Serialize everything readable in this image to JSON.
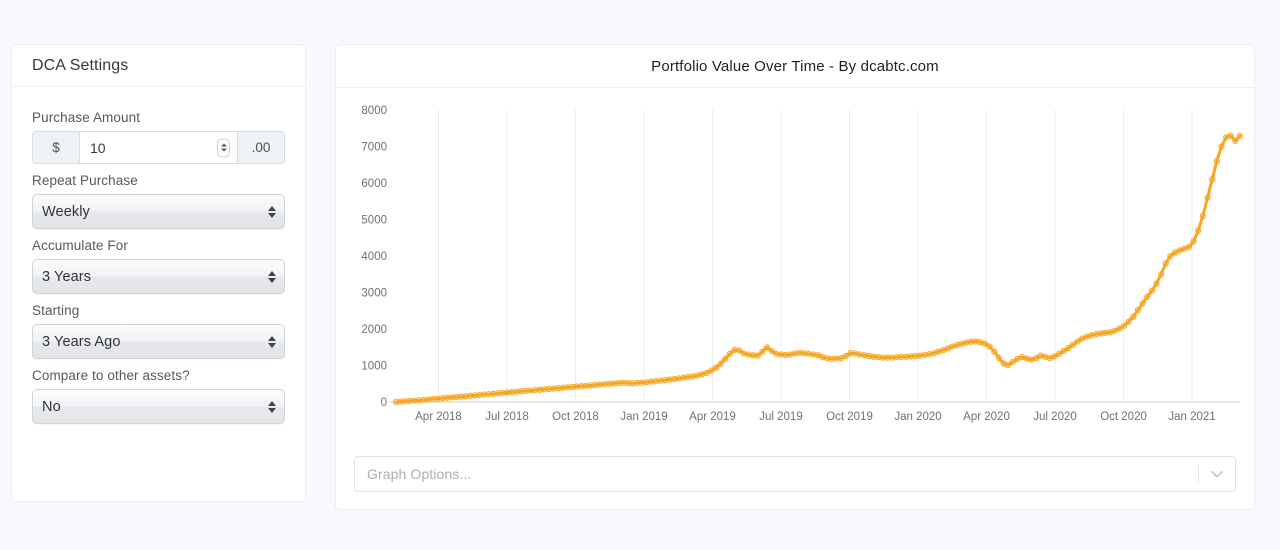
{
  "sidebar": {
    "title": "DCA Settings",
    "fields": {
      "purchase_amount": {
        "label": "Purchase Amount",
        "currency_symbol": "$",
        "value": "10",
        "cents_suffix": ".00"
      },
      "repeat_purchase": {
        "label": "Repeat Purchase",
        "value": "Weekly"
      },
      "accumulate_for": {
        "label": "Accumulate For",
        "value": "3 Years"
      },
      "starting": {
        "label": "Starting",
        "value": "3 Years Ago"
      },
      "compare": {
        "label": "Compare to other assets?",
        "value": "No"
      }
    }
  },
  "chart_panel": {
    "title": "Portfolio Value Over Time - By dcabtc.com",
    "graph_options_placeholder": "Graph Options...",
    "dropdown_icon": "chevron-down-icon"
  },
  "colors": {
    "series": "#f5a623",
    "page_background": "#f7f9fc",
    "card_border": "#e9edf2",
    "gridline": "#ececf0",
    "axis_text": "#6d7175"
  },
  "chart_data": {
    "type": "line",
    "title": "Portfolio Value Over Time - By dcabtc.com",
    "xlabel": "",
    "ylabel": "",
    "ylim": [
      0,
      8000
    ],
    "yticks": [
      0,
      1000,
      2000,
      3000,
      4000,
      5000,
      6000,
      7000,
      8000
    ],
    "xticks": [
      "Apr 2018",
      "Jul 2018",
      "Oct 2018",
      "Jan 2019",
      "Apr 2019",
      "Jul 2019",
      "Oct 2019",
      "Jan 2020",
      "Apr 2020",
      "Jul 2020",
      "Oct 2020",
      "Jan 2021"
    ],
    "grid": "vertical-only",
    "legend": "none",
    "markers": "open-circle",
    "series": [
      {
        "name": "Portfolio Value",
        "color": "#f5a623",
        "x_start": "Jan 2018",
        "x_end": "Jan 2021",
        "values": [
          0,
          10,
          20,
          30,
          42,
          52,
          60,
          72,
          84,
          92,
          104,
          115,
          126,
          136,
          148,
          158,
          170,
          182,
          192,
          204,
          214,
          226,
          238,
          248,
          260,
          272,
          282,
          294,
          304,
          316,
          326,
          336,
          348,
          358,
          370,
          380,
          390,
          402,
          412,
          424,
          434,
          446,
          456,
          466,
          478,
          488,
          498,
          510,
          520,
          530,
          520,
          512,
          520,
          530,
          542,
          556,
          570,
          584,
          600,
          616,
          630,
          648,
          666,
          686,
          706,
          730,
          760,
          800,
          860,
          940,
          1050,
          1180,
          1320,
          1430,
          1410,
          1330,
          1300,
          1280,
          1270,
          1380,
          1500,
          1400,
          1320,
          1300,
          1290,
          1300,
          1330,
          1350,
          1340,
          1320,
          1300,
          1280,
          1230,
          1200,
          1180,
          1190,
          1200,
          1260,
          1340,
          1330,
          1300,
          1280,
          1260,
          1240,
          1230,
          1220,
          1215,
          1220,
          1230,
          1235,
          1240,
          1250,
          1260,
          1270,
          1290,
          1310,
          1340,
          1380,
          1420,
          1470,
          1520,
          1560,
          1600,
          1630,
          1650,
          1660,
          1640,
          1600,
          1520,
          1380,
          1210,
          1060,
          1010,
          1100,
          1180,
          1230,
          1190,
          1160,
          1200,
          1270,
          1240,
          1200,
          1250,
          1320,
          1400,
          1480,
          1570,
          1660,
          1740,
          1790,
          1830,
          1860,
          1880,
          1900,
          1910,
          1950,
          2010,
          2090,
          2200,
          2340,
          2520,
          2700,
          2880,
          3050,
          3250,
          3500,
          3800,
          4000,
          4100,
          4150,
          4200,
          4250,
          4400,
          4700,
          5100,
          5600,
          6100,
          6600,
          7000,
          7250,
          7300,
          7150,
          7300
        ]
      }
    ]
  }
}
